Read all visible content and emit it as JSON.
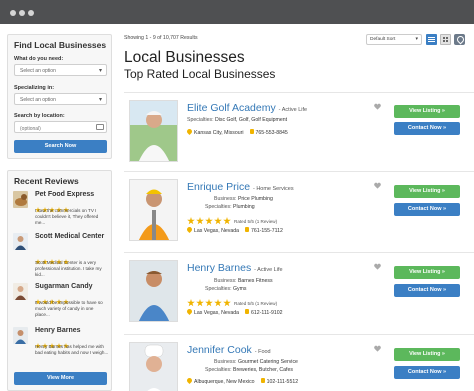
{
  "sidebar": {
    "find_title": "Find Local Businesses",
    "need_label": "What do you need:",
    "need_placeholder": "Select an option",
    "spec_label": "Specializing in:",
    "spec_placeholder": "Select an option",
    "loc_label": "Search by location:",
    "loc_placeholder": "(optional)",
    "search_button": "Search Now",
    "reviews_title": "Recent Reviews",
    "reviews": [
      {
        "name": "Pet Food Express",
        "text": "I saw the commercials on TV I couldn't believe it, They offered me...",
        "stars": 5
      },
      {
        "name": "Scott Medical Center",
        "text": "Scott Medical Center is a very professional institution. I take my kid...",
        "stars": 5
      },
      {
        "name": "Sugarman Candy",
        "text": "It would be impossible to have so much variety of candy in one place...",
        "stars": 5
      },
      {
        "name": "Henry Barnes",
        "text": "Henry Barnes has helped me with bad eating habits and now I weigh...",
        "stars": 5
      }
    ],
    "view_more": "View More"
  },
  "header": {
    "showing": "Showing 1 - 9 of 10,707 Results",
    "sort_value": "Default Sort",
    "title": "Local Businesses",
    "subtitle": "Top Rated Local Businesses"
  },
  "listings": [
    {
      "name": "Elite Golf Academy",
      "category": "- Active Life",
      "business": "",
      "specialties": "Disc Golf, Golf, Golf Equipment",
      "rated": "",
      "location": "Kansas City, Missouri",
      "phone": "765-553-8845",
      "stars": 0
    },
    {
      "name": "Enrique Price",
      "category": "- Home Services",
      "business": "Price Plumbing",
      "specialties": "Plumbing",
      "rated": "Rated 5/5 (1 Review)",
      "location": "Las Vegas, Nevada",
      "phone": "761-155-7112",
      "stars": 5
    },
    {
      "name": "Henry Barnes",
      "category": "- Active Life",
      "business": "Barnes Fitness",
      "specialties": "Gyms",
      "rated": "Rated 5/5 (1 Review)",
      "location": "Las Vegas, Nevada",
      "phone": "612-111-9102",
      "stars": 5
    },
    {
      "name": "Jennifer Cook",
      "category": "- Food",
      "business": "Gourmet Catering Service",
      "specialties": "Breweries, Butcher, Cafes",
      "rated": "",
      "location": "Albuquerque, New Mexico",
      "phone": "102-111-5512",
      "stars": 0
    }
  ],
  "labels": {
    "business": "Business:",
    "specialties": "Specialties:",
    "view_listing": "View Listing »",
    "contact_now": "Contact Now »"
  },
  "colors": {
    "accent_blue": "#3b7fc4",
    "accent_green": "#5cb85c",
    "star_gold": "#f0b400",
    "link_blue": "#3478b6"
  }
}
